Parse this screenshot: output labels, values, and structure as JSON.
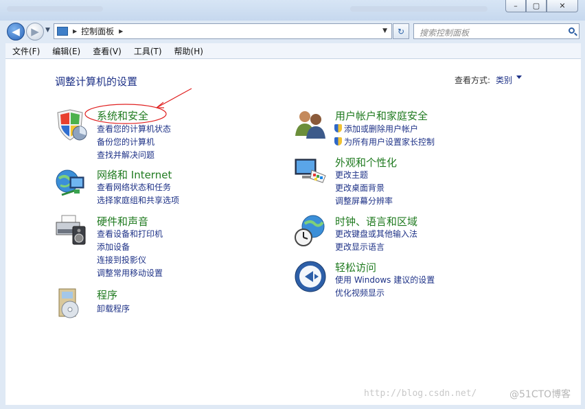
{
  "window": {
    "minimize_glyph": "–",
    "maximize_glyph": "▢",
    "close_glyph": "✕"
  },
  "nav": {
    "back_glyph": "◀",
    "forward_glyph": "▶",
    "breadcrumb_sep": "▶",
    "address": "控制面板",
    "address_end_sep": "▶",
    "dropdown_glyph": "▼",
    "refresh_glyph": "↻"
  },
  "search": {
    "placeholder": "搜索控制面板"
  },
  "menu": {
    "file": "文件(F)",
    "edit": "编辑(E)",
    "view": "查看(V)",
    "tools": "工具(T)",
    "help": "帮助(H)"
  },
  "page": {
    "title": "调整计算机的设置",
    "view_by_label": "查看方式:",
    "view_by_value": "类别"
  },
  "categories": [
    {
      "title": "系统和安全",
      "icon": "shield-chart-icon",
      "links": [
        "查看您的计算机状态",
        "备份您的计算机",
        "查找并解决问题"
      ]
    },
    {
      "title": "网络和 Internet",
      "icon": "network-globe-icon",
      "links": [
        "查看网络状态和任务",
        "选择家庭组和共享选项"
      ]
    },
    {
      "title": "硬件和声音",
      "icon": "printer-speaker-icon",
      "links": [
        "查看设备和打印机",
        "添加设备",
        "连接到投影仪",
        "调整常用移动设置"
      ]
    },
    {
      "title": "程序",
      "icon": "programs-disc-icon",
      "links": [
        "卸载程序"
      ]
    },
    {
      "title": "用户帐户和家庭安全",
      "icon": "users-icon",
      "links": [
        "添加或删除用户帐户",
        "为所有用户设置家长控制"
      ]
    },
    {
      "title": "外观和个性化",
      "icon": "monitor-palette-icon",
      "links": [
        "更改主题",
        "更改桌面背景",
        "调整屏幕分辨率"
      ]
    },
    {
      "title": "时钟、语言和区域",
      "icon": "clock-globe-icon",
      "links": [
        "更改键盘或其他输入法",
        "更改显示语言"
      ]
    },
    {
      "title": "轻松访问",
      "icon": "ease-of-access-icon",
      "links": [
        "使用 Windows 建议的设置",
        "优化视频显示"
      ]
    }
  ],
  "watermark": {
    "url": "http://blog.csdn.net/",
    "handle": "@51CTO博客"
  },
  "colors": {
    "link": "#1e3287",
    "category_title": "#1f7a1f",
    "annotation": "#e02020"
  }
}
